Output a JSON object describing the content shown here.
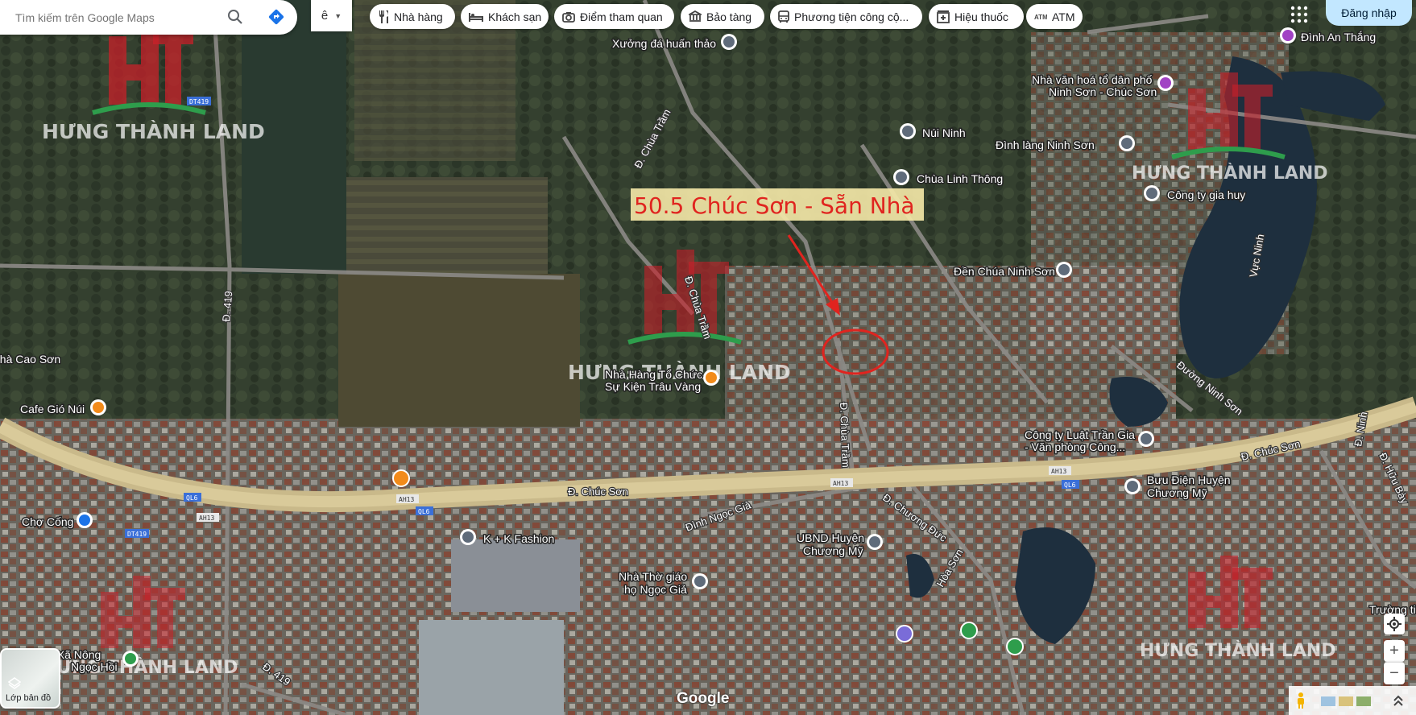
{
  "search": {
    "placeholder": "Tìm kiếm trên Google Maps"
  },
  "language_button": {
    "label": "ê"
  },
  "chips": [
    {
      "label": "Nhà hàng",
      "icon": "restaurant-icon"
    },
    {
      "label": "Khách sạn",
      "icon": "hotel-icon"
    },
    {
      "label": "Điểm tham quan",
      "icon": "camera-icon"
    },
    {
      "label": "Bảo tàng",
      "icon": "museum-icon"
    },
    {
      "label": "Phương tiện công cộ...",
      "icon": "bus-icon"
    },
    {
      "label": "Hiệu thuốc",
      "icon": "pharmacy-icon"
    },
    {
      "label": "ATM",
      "icon": "atm-icon"
    }
  ],
  "signin": {
    "label": "Đăng nhập"
  },
  "layers": {
    "label": "Lớp bản đồ"
  },
  "branding": {
    "google": "Google"
  },
  "annotation": {
    "text": "50.5 Chúc Sơn - Sẵn Nhà",
    "color": "#e0241f",
    "bg": "#f5e9a8"
  },
  "watermark": {
    "text": "HƯNG THÀNH LAND",
    "logo_color": "#c8202a",
    "accent": "#2e9d4c"
  },
  "places": [
    {
      "name": "Xưởng đá huấn thảo",
      "icon": "pin-icon"
    },
    {
      "name": "Đình An Thắng",
      "icon": "pin-icon"
    },
    {
      "name": "Nhà văn hoá tổ dân phố",
      "icon": "pin-icon"
    },
    {
      "name": "Ninh Sơn - Chúc Sơn",
      "icon": "pin-icon"
    },
    {
      "name": "Núi Ninh",
      "icon": "mountain-icon"
    },
    {
      "name": "Đình làng Ninh Sơn",
      "icon": "temple-icon"
    },
    {
      "name": "Chùa Linh Thông",
      "icon": "pagoda-icon"
    },
    {
      "name": "Công ty gia huy",
      "icon": "pin-icon"
    },
    {
      "name": "Đền Chúa Ninh Sơn",
      "icon": "temple-icon"
    },
    {
      "name": "Nhà Hàng Tổ Chức",
      "icon": "restaurant-icon"
    },
    {
      "name": "Sự Kiện Trâu Vàng",
      "icon": "restaurant-icon"
    },
    {
      "name": "Cafe Gió Núi",
      "icon": "cafe-icon"
    },
    {
      "name": "nhà Cao Sơn",
      "icon": "pin-icon"
    },
    {
      "name": "Công ty Luật Trần Gia",
      "icon": "pin-icon"
    },
    {
      "name": "- Văn phòng Công...",
      "icon": "pin-icon"
    },
    {
      "name": "Bưu Điện Huyện",
      "icon": "mail-icon"
    },
    {
      "name": "Chương Mỹ",
      "icon": "mail-icon"
    },
    {
      "name": "Chợ Cống",
      "icon": "shop-icon"
    },
    {
      "name": "K + K Fashion",
      "icon": "pin-icon"
    },
    {
      "name": "UBND Huyện",
      "icon": "government-icon"
    },
    {
      "name": "Chương Mỹ",
      "icon": "government-icon"
    },
    {
      "name": "Nhà Thờ giáo",
      "icon": "church-icon"
    },
    {
      "name": "họ Ngọc Giả",
      "icon": "church-icon"
    },
    {
      "name": "Trường ti",
      "icon": "pin-icon"
    },
    {
      "name": "Học Xã Nông",
      "icon": "pin-icon"
    },
    {
      "name": "Ngọc Hồi",
      "icon": "pin-icon"
    }
  ],
  "roads": [
    {
      "name": "Đ. Chúc Sơn"
    },
    {
      "name": "Đ. Chúc Sơn"
    },
    {
      "name": "Đ. Chùa Trầm"
    },
    {
      "name": "Đ. Chùa Trầm"
    },
    {
      "name": "Đ. Chùa Trầm"
    },
    {
      "name": "Đường Ninh Sơn"
    },
    {
      "name": "Đ. 419"
    },
    {
      "name": "Đ. 419"
    },
    {
      "name": "Đ. Chương Đức"
    },
    {
      "name": "Đình Ngọc Giả"
    },
    {
      "name": "Hòa Sơn"
    },
    {
      "name": "Vực Ninh"
    },
    {
      "name": "Đ. Ninh"
    },
    {
      "name": "Đ. Hữu Bày"
    }
  ],
  "shields": [
    "DT419",
    "QL6",
    "AH13",
    "QL6",
    "AH13",
    "AH13",
    "QL6",
    "AH13",
    "DT419"
  ]
}
